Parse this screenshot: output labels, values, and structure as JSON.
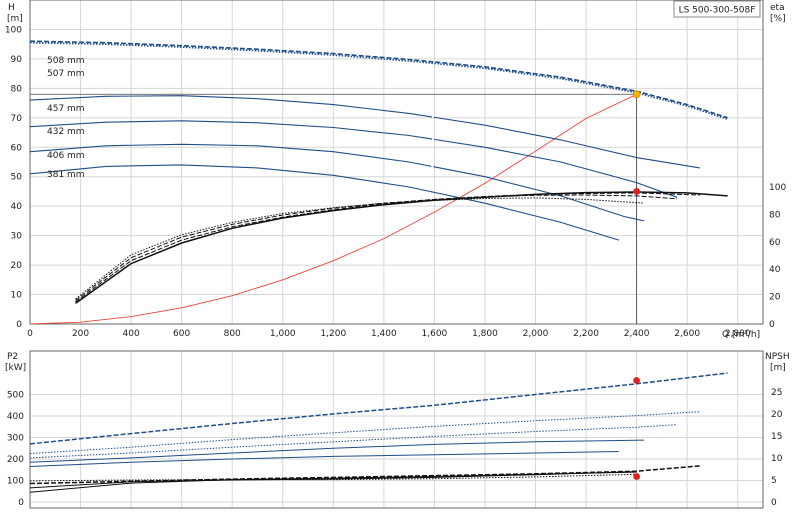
{
  "chart_data": [
    {
      "type": "line",
      "title_box": "LS 500-300-508F",
      "ylabel": "H",
      "yunit": "[m]",
      "y2label": "eta",
      "y2unit": "[%]",
      "xlabel": "Q",
      "xunit": "[m³/h]",
      "xlim": [
        0,
        2900
      ],
      "ylim": [
        0,
        110
      ],
      "y2lim": [
        0,
        100
      ],
      "xticks": [
        0,
        200,
        400,
        600,
        800,
        1000,
        1200,
        1400,
        1600,
        1800,
        2000,
        2200,
        2400,
        2600,
        2800
      ],
      "xtick_labels": [
        "0",
        "200",
        "400",
        "600",
        "800",
        "1,000",
        "1,200",
        "1,400",
        "1,600",
        "1,800",
        "2,000",
        "2,200",
        "2,400",
        "2,600",
        "2,800"
      ],
      "yticks": [
        0,
        10,
        20,
        30,
        40,
        50,
        60,
        70,
        80,
        90,
        100
      ],
      "y2ticks": [
        0,
        20,
        40,
        60,
        80,
        100
      ],
      "grid": true,
      "head_series": [
        {
          "name": "508 mm",
          "style": "dashed",
          "x": [
            0,
            300,
            600,
            900,
            1200,
            1500,
            1800,
            2100,
            2400,
            2600,
            2760
          ],
          "y": [
            96,
            95.5,
            94.5,
            93.3,
            91.8,
            89.8,
            87.3,
            83.8,
            79,
            74.5,
            70
          ]
        },
        {
          "name": "507 mm",
          "style": "dotted",
          "x": [
            0,
            300,
            600,
            900,
            1200,
            1500,
            1800,
            2100,
            2400,
            2600,
            2760
          ],
          "y": [
            95.5,
            95,
            94,
            92.8,
            91.3,
            89.3,
            86.8,
            83.3,
            78.5,
            74,
            69.5
          ]
        },
        {
          "name": "457 mm",
          "style": "solid_then_dashed",
          "x": [
            0,
            300,
            600,
            900,
            1200,
            1500,
            1800,
            2100,
            2400,
            2650
          ],
          "y": [
            76,
            77.3,
            77.5,
            76.5,
            74.5,
            71.5,
            67.5,
            62.5,
            56.5,
            53
          ]
        },
        {
          "name": "432 mm",
          "style": "solid_then_dashed",
          "x": [
            0,
            300,
            600,
            900,
            1200,
            1500,
            1800,
            2100,
            2400,
            2560
          ],
          "y": [
            67,
            68.5,
            69,
            68.3,
            66.7,
            64,
            60,
            55,
            48,
            43
          ]
        },
        {
          "name": "406 mm",
          "style": "solid_then_dashed",
          "x": [
            0,
            300,
            600,
            900,
            1200,
            1500,
            1800,
            2100,
            2350,
            2430
          ],
          "y": [
            58.5,
            60.5,
            61,
            60.5,
            58.5,
            55,
            50,
            43.5,
            36.5,
            35
          ]
        },
        {
          "name": "381 mm",
          "style": "solid",
          "x": [
            0,
            300,
            600,
            900,
            1200,
            1500,
            1800,
            2100,
            2330
          ],
          "y": [
            51,
            53.5,
            54,
            53,
            50.5,
            46.5,
            41,
            34.5,
            28.5
          ]
        }
      ],
      "eta_series": [
        {
          "style": "solid",
          "x": [
            180,
            400,
            600,
            800,
            1000,
            1200,
            1400,
            1600,
            1800,
            2000,
            2200,
            2400,
            2600,
            2760
          ],
          "y": [
            7,
            20.5,
            27.5,
            32.5,
            36,
            38.5,
            40.5,
            42,
            43,
            44,
            44.6,
            44.8,
            44.5,
            43.5
          ]
        },
        {
          "style": "dashed",
          "x": [
            180,
            400,
            600,
            800,
            1000,
            1200,
            1400,
            1600,
            1800,
            2000,
            2200,
            2400,
            2650
          ],
          "y": [
            7.5,
            21.5,
            28.5,
            33,
            36.3,
            38.8,
            40.8,
            42.3,
            43.3,
            44,
            44.3,
            44.5,
            43.8
          ]
        },
        {
          "style": "dashed",
          "x": [
            180,
            400,
            600,
            800,
            1000,
            1200,
            1400,
            1600,
            1800,
            2000,
            2200,
            2400,
            2560
          ],
          "y": [
            8,
            22.5,
            29.5,
            33.8,
            37,
            39.3,
            41,
            42.3,
            43.2,
            43.7,
            43.8,
            43.5,
            42.5
          ]
        },
        {
          "style": "dotted",
          "x": [
            180,
            400,
            600,
            800,
            1000,
            1200,
            1400,
            1600,
            1800,
            2000,
            2200,
            2430
          ],
          "y": [
            8.5,
            23.5,
            30.3,
            34.5,
            37.5,
            39.5,
            41,
            42,
            42.6,
            42.8,
            42.3,
            41
          ]
        }
      ],
      "system_curve": {
        "x": [
          0,
          200,
          400,
          600,
          800,
          1000,
          1200,
          1400,
          1600,
          1800,
          2000,
          2200,
          2400
        ],
        "y": [
          0,
          0.6,
          2.5,
          5.5,
          9.6,
          15,
          21.5,
          29,
          38,
          47.8,
          58.7,
          69.8,
          78
        ]
      },
      "duty_point": {
        "x": 2400,
        "y": 78
      },
      "eta_point": {
        "x": 2400,
        "y": 45
      }
    },
    {
      "type": "line",
      "ylabel": "P2",
      "yunit": "[kW]",
      "y2label": "NPSH",
      "y2unit": "[m]",
      "xlim": [
        0,
        2900
      ],
      "ylim": [
        0,
        600
      ],
      "y2lim": [
        0,
        30
      ],
      "yticks": [
        0,
        100,
        200,
        300,
        400,
        500
      ],
      "y2ticks": [
        0,
        5,
        10,
        15,
        20,
        25
      ],
      "grid": true,
      "power_series": [
        {
          "style": "dashed",
          "x": [
            0,
            400,
            800,
            1200,
            1600,
            2000,
            2400,
            2760
          ],
          "y": [
            270,
            318,
            365,
            410,
            450,
            500,
            550,
            600
          ]
        },
        {
          "style": "dotted",
          "x": [
            0,
            400,
            800,
            1200,
            1600,
            2000,
            2400,
            2650
          ],
          "y": [
            225,
            255,
            290,
            322,
            352,
            378,
            402,
            420
          ]
        },
        {
          "style": "dotted",
          "x": [
            0,
            400,
            800,
            1200,
            1600,
            2000,
            2400,
            2560
          ],
          "y": [
            205,
            228,
            255,
            280,
            305,
            328,
            348,
            360
          ]
        },
        {
          "style": "solid",
          "x": [
            0,
            400,
            800,
            1200,
            1600,
            2000,
            2430
          ],
          "y": [
            185,
            205,
            228,
            250,
            268,
            280,
            288
          ]
        },
        {
          "style": "solid",
          "x": [
            0,
            400,
            800,
            1200,
            1600,
            2000,
            2330
          ],
          "y": [
            165,
            185,
            200,
            212,
            220,
            228,
            235
          ]
        }
      ],
      "npsh_series": [
        {
          "style": "dashed",
          "x": [
            0,
            400,
            800,
            1200,
            1600,
            2000,
            2400,
            2650
          ],
          "y": [
            4.2,
            4.7,
            5.2,
            5.6,
            6,
            6.4,
            7,
            8.2
          ]
        },
        {
          "style": "solid",
          "x": [
            0,
            400,
            800,
            1200,
            1600,
            2000,
            2400
          ],
          "y": [
            2.2,
            4.3,
            5.1,
            5.4,
            5.8,
            6.3,
            6.8
          ]
        },
        {
          "style": "solid",
          "x": [
            0,
            400,
            800,
            1200,
            1600,
            2000,
            2400
          ],
          "y": [
            3.2,
            4.6,
            5,
            5.2,
            5.6,
            6.2,
            6.9
          ]
        },
        {
          "style": "dotted",
          "x": [
            0,
            400,
            800,
            1200,
            1600,
            2000,
            2400
          ],
          "y": [
            4.8,
            5,
            5.1,
            5.1,
            5.3,
            5.7,
            6.3
          ]
        }
      ],
      "power_point": {
        "x": 2400,
        "y": 565
      },
      "npsh_point": {
        "x": 2400,
        "y": 5.8
      }
    }
  ],
  "colors": {
    "blue": "#1f4e89",
    "black": "#111111",
    "red": "#e8453c",
    "point_red": "#e02020",
    "point_yellow": "#f0b400",
    "grid": "#d6d6d6",
    "axis": "#666666"
  }
}
